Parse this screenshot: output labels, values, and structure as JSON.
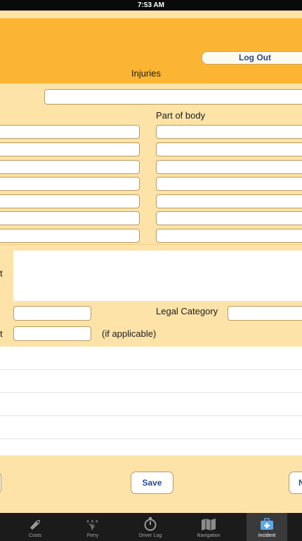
{
  "status_bar": {
    "time": "7:53 AM"
  },
  "header": {
    "logout_label": "Log Out",
    "section_title": "Injuries"
  },
  "form": {
    "part_of_body_label": "Part of body",
    "description_label_fragment": "t",
    "legal_category_label": "Legal Category",
    "extra_label_fragment": "t",
    "if_applicable_label": "(if applicable)"
  },
  "actions": {
    "save_label": "Save",
    "next_fragment": "N"
  },
  "tab_bar": {
    "tabs": [
      {
        "label": "Costs",
        "icon": "price-tag-icon"
      },
      {
        "label": "Ferry",
        "icon": "play-diagram-icon"
      },
      {
        "label": "Driver Log",
        "icon": "stopwatch-icon"
      },
      {
        "label": "Navigation",
        "icon": "map-icon"
      },
      {
        "label": "Incident",
        "icon": "first-aid-kit-icon"
      }
    ],
    "active": "Incident"
  }
}
